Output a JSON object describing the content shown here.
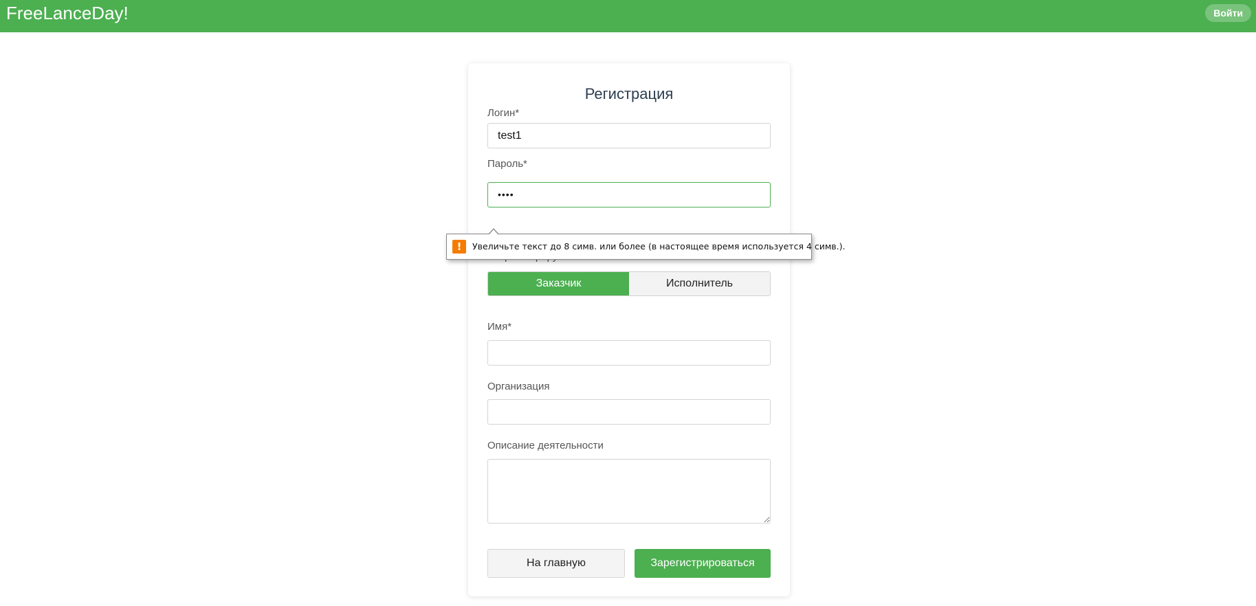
{
  "header": {
    "brand": "FreeLanceDay!",
    "login_button": "Войти",
    "accent_color": "#4caf50"
  },
  "form": {
    "title": "Регистрация",
    "login": {
      "label": "Логин*",
      "value": "test1"
    },
    "password": {
      "label": "Пароль*",
      "value": "••••"
    },
    "role": {
      "label": "Вы регистрируетесь как:",
      "options": [
        "Заказчик",
        "Исполнитель"
      ],
      "selected": "Заказчик"
    },
    "name": {
      "label": "Имя*",
      "value": ""
    },
    "organization": {
      "label": "Организация",
      "value": ""
    },
    "description": {
      "label": "Описание деятельности",
      "value": ""
    },
    "buttons": {
      "home": "На главную",
      "register": "Зарегистрироваться"
    }
  },
  "validation_tooltip": {
    "icon": "warning-icon",
    "message": "Увеличьте текст до 8 симв. или более (в настоящее время используется 4 симв.)."
  }
}
